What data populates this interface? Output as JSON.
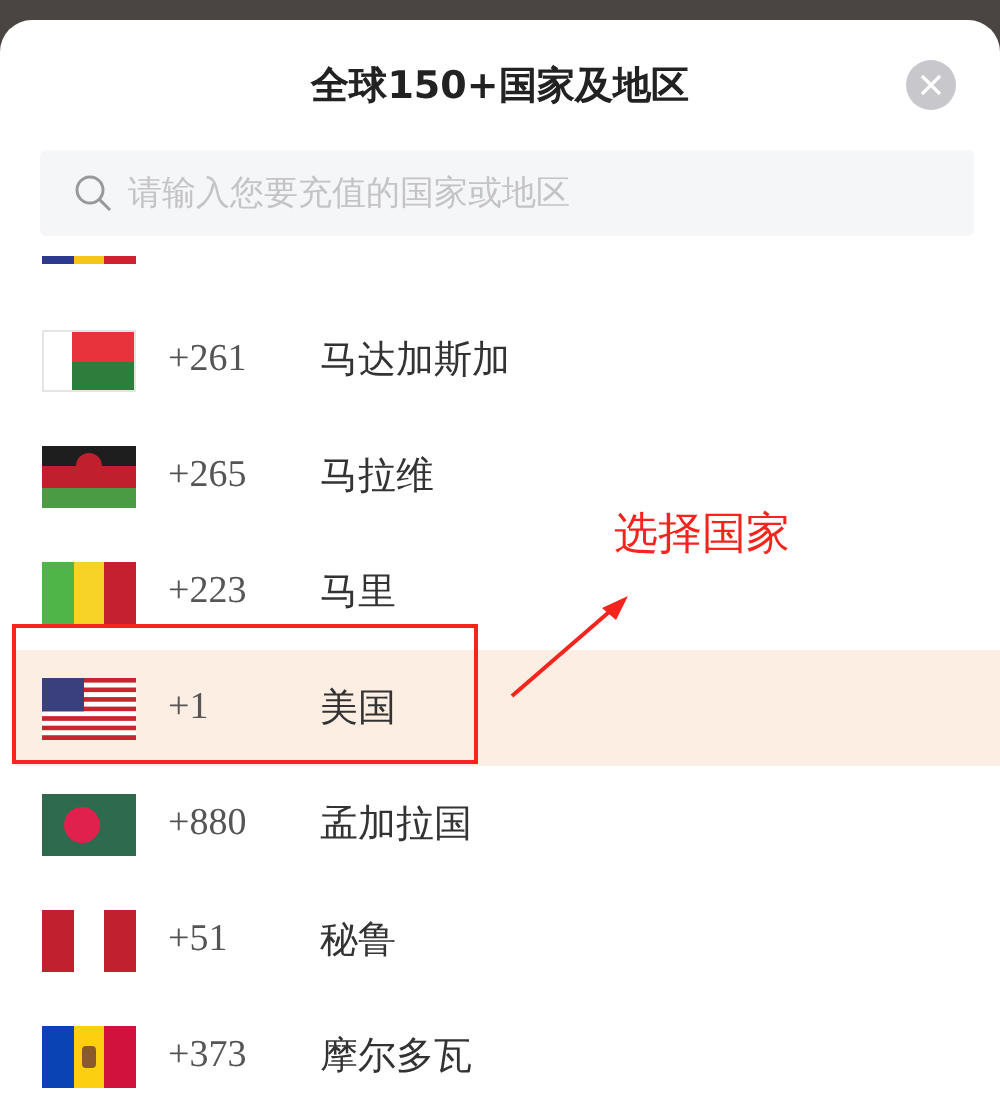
{
  "title": "全球150+国家及地区",
  "search": {
    "placeholder": "请输入您要充值的国家或地区"
  },
  "cut_row": {
    "kind": "romania"
  },
  "rows": [
    {
      "kind": "madagascar",
      "code": "+261",
      "name": "马达加斯加",
      "selected": false
    },
    {
      "kind": "malawi",
      "code": "+265",
      "name": "马拉维",
      "selected": false
    },
    {
      "kind": "mali",
      "code": "+223",
      "name": "马里",
      "selected": false
    },
    {
      "kind": "usa",
      "code": "+1",
      "name": "美国",
      "selected": true
    },
    {
      "kind": "bangladesh",
      "code": "+880",
      "name": "孟加拉国",
      "selected": false
    },
    {
      "kind": "peru",
      "code": "+51",
      "name": "秘鲁",
      "selected": false
    },
    {
      "kind": "moldova",
      "code": "+373",
      "name": "摩尔多瓦",
      "selected": false
    }
  ],
  "annotation": {
    "label": "选择国家"
  }
}
